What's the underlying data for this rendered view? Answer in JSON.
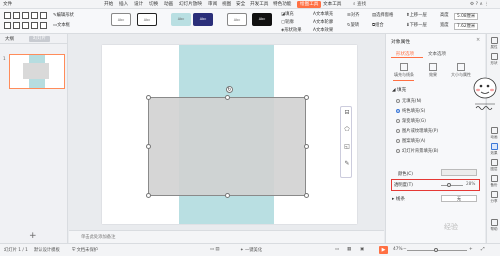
{
  "menubar": {
    "file": "文件",
    "tabs": [
      "开始",
      "插入",
      "设计",
      "切换",
      "动画",
      "幻灯片放映",
      "审阅",
      "视图",
      "安全",
      "开发工具",
      "特色功能",
      "绘图工具",
      "文本工具"
    ],
    "active_tab": "绘图工具",
    "search": "查找",
    "user_icons": "⚙ ? ∧ ⋮"
  },
  "ribbon": {
    "edit_shape": "编辑形状",
    "text_box": "文本框",
    "gallery": [
      "Abc",
      "Abc",
      "Abc",
      "Abc",
      "Abc",
      "Abc"
    ],
    "fill": "填充",
    "outline": "轮廓",
    "shape_effect": "形状效果",
    "text_fill": "文本填充",
    "text_outline": "文本轮廓",
    "text_effect": "文本效果",
    "arrange": "对齐",
    "rotate": "旋转",
    "select_pane": "选择窗格",
    "up_layer": "上移一层",
    "down_layer": "下移一层",
    "group": "组合",
    "height": "高度",
    "width": "宽度",
    "height_val": "5.08厘米",
    "width_val": "7.62厘米"
  },
  "leftpanel": {
    "tab_outline": "大纲",
    "tab_slides": "幻灯片",
    "slide_number": "1",
    "add_slide": "+"
  },
  "canvas": {
    "notes_placeholder": "单击此处添加备注"
  },
  "rightpanel": {
    "title": "对象属性",
    "close": "×",
    "tab_shape": "形状选项",
    "tab_text": "文本选项",
    "sub_fill": "填充与线条",
    "sub_effect": "效果",
    "sub_size": "大小与属性",
    "fill_header": "◢ 填充",
    "fill_options": [
      "无填充(N)",
      "纯色填充(S)",
      "渐变填充(G)",
      "图片或纹理填充(P)",
      "图案填充(A)",
      "幻灯片背景填充(B)"
    ],
    "fill_selected": 1,
    "color_label": "颜色(C)",
    "transparency_label": "透明度(T)",
    "transparency_value": "28%",
    "transparency_fraction": 0.28,
    "line_header": "▸ 线条",
    "line_value": "无",
    "watermark": "经验"
  },
  "sidetools": [
    {
      "label": "属性",
      "icon": "properties-icon"
    },
    {
      "label": "形状",
      "icon": "shape-icon"
    },
    {
      "label": "动画",
      "icon": "animation-icon"
    },
    {
      "label": "效果",
      "icon": "effect-icon"
    },
    {
      "label": "图层",
      "icon": "layer-icon"
    },
    {
      "label": "备份",
      "icon": "backup-icon"
    },
    {
      "label": "分享",
      "icon": "share-icon"
    },
    {
      "label": "帮助",
      "icon": "help-icon"
    }
  ],
  "statusbar": {
    "slide_info": "幻灯片 1 / 1",
    "theme": "默认设计模板",
    "backup": "文档未保护",
    "beautify": "一键美化",
    "zoom": "47%",
    "zoom_minus": "−",
    "zoom_plus": "+"
  },
  "colors": {
    "accent": "#ff7043",
    "band": "#b9dfe2",
    "shape_fill": "#d3d3d3",
    "highlight_box": "#e53935"
  }
}
